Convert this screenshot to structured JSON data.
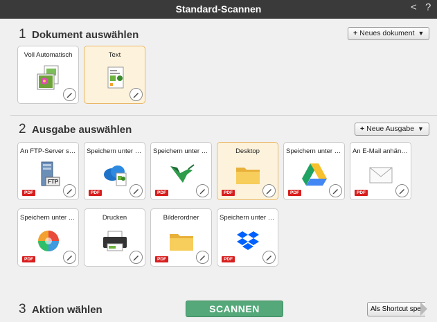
{
  "title": "Standard-Scannen",
  "titlebar": {
    "back_glyph": "<",
    "help_glyph": "?"
  },
  "section1": {
    "num": "1",
    "label": "Dokument auswählen",
    "new_button": "Neues dokument",
    "cards": [
      {
        "label": "Voll Automatisch",
        "icon": "auto-document-icon",
        "selected": false
      },
      {
        "label": "Text",
        "icon": "text-document-icon",
        "selected": true
      }
    ]
  },
  "section2": {
    "num": "2",
    "label": "Ausgabe auswählen",
    "new_button": "Neue Ausgabe",
    "cards": [
      {
        "label": "An FTP-Server sen...",
        "icon": "ftp-server-icon",
        "pdf": "PDF",
        "selected": false
      },
      {
        "label": "Speichern unter O...",
        "icon": "onedrive-icon",
        "pdf": "PDF",
        "selected": false
      },
      {
        "label": "Speichern unter Su...",
        "icon": "hummingbird-icon",
        "pdf": "PDF",
        "selected": false
      },
      {
        "label": "Desktop",
        "icon": "folder-icon",
        "pdf": "PDF",
        "selected": true
      },
      {
        "label": "Speichern unter G...",
        "icon": "google-drive-icon",
        "pdf": "PDF",
        "selected": false
      },
      {
        "label": "An E-Mail anhängen",
        "icon": "email-icon",
        "pdf": "PDF",
        "selected": false
      },
      {
        "label": "Speichern unter Mi...",
        "icon": "photos-icon",
        "pdf": "PDF",
        "selected": false
      },
      {
        "label": "Drucken",
        "icon": "printer-icon",
        "pdf": "",
        "selected": false
      },
      {
        "label": "Bilderordner",
        "icon": "folder-icon",
        "pdf": "PDF",
        "selected": false
      },
      {
        "label": "Speichern unter Dr...",
        "icon": "dropbox-icon",
        "pdf": "PDF",
        "selected": false
      }
    ]
  },
  "section3": {
    "num": "3",
    "label": "Aktion wählen",
    "scan_button": "SCANNEN",
    "shortcut_button": "Als Shortcut spei"
  },
  "colors": {
    "titlebar": "#3a3a3a",
    "selected_bg": "#fdf3dc",
    "selected_border": "#e9b768",
    "scan": "#55a87a",
    "pdf_badge": "#d81e1e"
  }
}
